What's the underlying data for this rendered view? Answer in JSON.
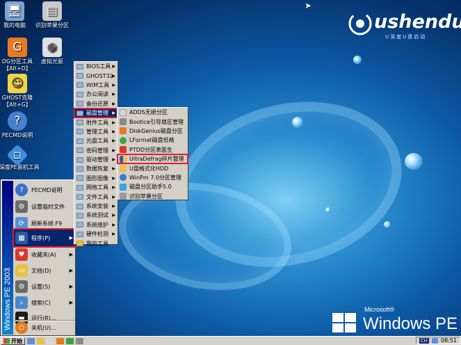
{
  "desktop": {
    "icons": [
      {
        "label": "我的电脑",
        "icon": "computer-icon",
        "color": "#7aa6d6"
      },
      {
        "label": "识别苹果分区",
        "icon": "disk-icon",
        "color": "#c9c9c9"
      },
      {
        "label": "DG分区工具【Alt+D】",
        "icon": "dg-icon",
        "color": "#e87a1e"
      },
      {
        "label": "虚拟光驱",
        "icon": "cd-icon",
        "color": "#e0e0e0"
      },
      {
        "label": "GHOST克隆【Alt+G】",
        "icon": "ghost-icon",
        "color": "#f1d34a"
      },
      {
        "label": "PECMD说明",
        "icon": "help-icon",
        "color": "#4a7fcf"
      },
      {
        "label": "U深度PE装机工具",
        "icon": "installer-icon",
        "color": "#3c8fe0"
      }
    ]
  },
  "logo": {
    "text": "ushendu",
    "sub": "U深度U盘启动"
  },
  "brand": {
    "company": "Microsoft®",
    "product": "Windows PE"
  },
  "start_menu": {
    "banner": "Windows PE 2003",
    "items": [
      {
        "label": "PECMD说明",
        "icon": "help-icon",
        "color": "#3a6fc7"
      },
      {
        "label": "设置临时文件",
        "icon": "settings-icon",
        "color": "#6b6b6b"
      },
      {
        "label": "刷新系统 F9",
        "icon": "refresh-icon",
        "color": "#5a8fd6"
      },
      {
        "label": "程序(P)",
        "icon": "programs-icon",
        "color": "#2c5aa0",
        "arrow": "▶"
      },
      {
        "label": "收藏夹(A)",
        "icon": "favorites-icon",
        "color": "#d83a2a",
        "arrow": "▶"
      },
      {
        "label": "文档(D)",
        "icon": "documents-icon",
        "color": "#e8c04a",
        "arrow": "▶"
      },
      {
        "label": "设置(S)",
        "icon": "control-icon",
        "color": "#6a6a6a",
        "arrow": "▶"
      },
      {
        "label": "搜索(C)",
        "icon": "search-icon",
        "color": "#4a88d0",
        "arrow": "▶"
      },
      {
        "label": "运行(R)...",
        "icon": "run-icon",
        "color": "#1a1a1a"
      },
      {
        "label": "关机(U)...",
        "icon": "shutdown-icon",
        "color": "#e07a1a"
      }
    ]
  },
  "programs_menu": [
    {
      "label": "BIOS工具",
      "arrow": "▶"
    },
    {
      "label": "GHOST32",
      "arrow": "▶"
    },
    {
      "label": "WIM工具",
      "arrow": "▶"
    },
    {
      "label": "办公阅读",
      "arrow": "▶"
    },
    {
      "label": "备份还原",
      "arrow": "▶"
    },
    {
      "label": "磁盘管理",
      "arrow": "▶"
    },
    {
      "label": "附件工具",
      "arrow": "▶"
    },
    {
      "label": "管理工具",
      "arrow": "▶"
    },
    {
      "label": "光盘工具",
      "arrow": "▶"
    },
    {
      "label": "密码管理",
      "arrow": "▶"
    },
    {
      "label": "驱动管理",
      "arrow": "▶"
    },
    {
      "label": "数据恢复",
      "arrow": "▶"
    },
    {
      "label": "图形图像",
      "arrow": "▶"
    },
    {
      "label": "网络工具",
      "arrow": "▶"
    },
    {
      "label": "文件工具",
      "arrow": "▶"
    },
    {
      "label": "系统安装",
      "arrow": "▶"
    },
    {
      "label": "系统测试",
      "arrow": "▶"
    },
    {
      "label": "系统维护",
      "arrow": "▶"
    },
    {
      "label": "硬件检测",
      "arrow": "▶"
    },
    {
      "label": "我的工具",
      "arrow": ""
    }
  ],
  "disk_menu": [
    {
      "label": "ADDS无损分区",
      "color": "#d9d9d9"
    },
    {
      "label": "Bootice引导扇区管理",
      "color": "#8a8a8a"
    },
    {
      "label": "DiskGenius磁盘分区",
      "color": "#e87a1e"
    },
    {
      "label": "LFormat磁盘低格",
      "color": "#3da23d"
    },
    {
      "label": "PTDD分区表医生",
      "color": "#d83a2a"
    },
    {
      "label": "UltraDefrag碎片整理",
      "color": "#2d5fb0"
    },
    {
      "label": "U盘格式化HDD",
      "color": "#e8c04a"
    },
    {
      "label": "WinPm 7.0分区管理",
      "color": "#3c7ad0"
    },
    {
      "label": "磁盘分区助手5.0",
      "color": "#3aa3d8"
    },
    {
      "label": "识别苹果分区",
      "color": "#9a9a9a"
    }
  ],
  "taskbar": {
    "start_label": "开始",
    "tray_lang": "CH",
    "clock": "08:51"
  }
}
